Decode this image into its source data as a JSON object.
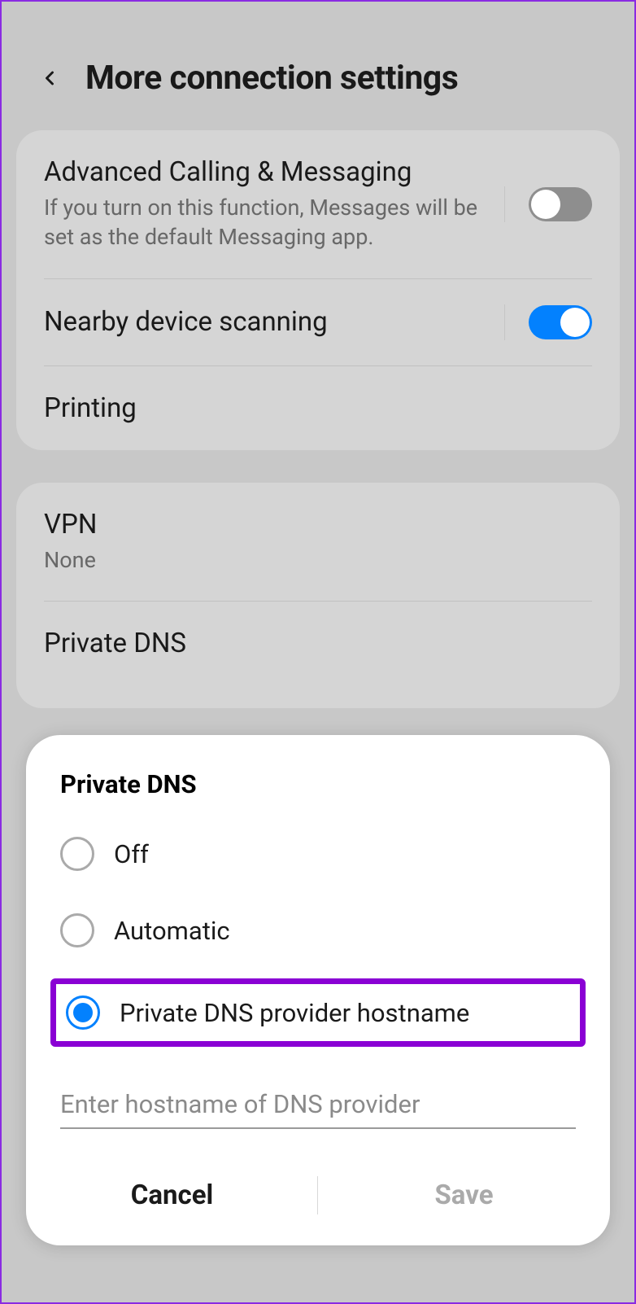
{
  "header": {
    "title": "More connection settings"
  },
  "card1": {
    "items": [
      {
        "title": "Advanced Calling & Messaging",
        "sub": "If you turn on this function, Messages will be set as the default Messaging app.",
        "toggle": "off"
      },
      {
        "title": "Nearby device scanning",
        "toggle": "on"
      },
      {
        "title": "Printing"
      }
    ]
  },
  "card2": {
    "items": [
      {
        "title": "VPN",
        "sub": "None"
      },
      {
        "title": "Private DNS"
      }
    ]
  },
  "dialog": {
    "title": "Private DNS",
    "options": [
      {
        "label": "Off",
        "selected": false
      },
      {
        "label": "Automatic",
        "selected": false
      },
      {
        "label": "Private DNS provider hostname",
        "selected": true
      }
    ],
    "placeholder": "Enter hostname of DNS provider",
    "cancel": "Cancel",
    "save": "Save"
  }
}
